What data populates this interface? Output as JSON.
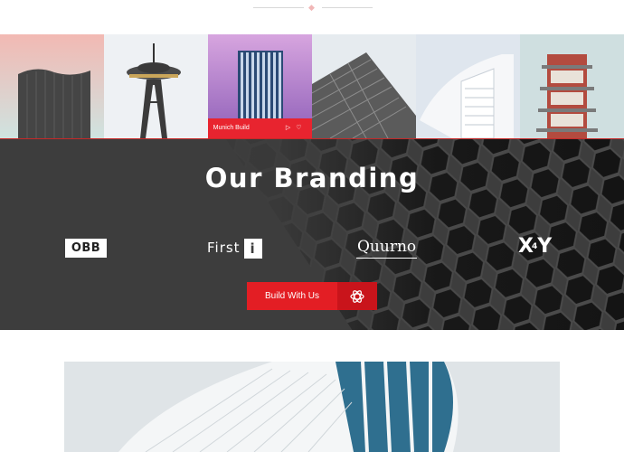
{
  "gallery": {
    "items": [
      {
        "name": "gallery-tile-1"
      },
      {
        "name": "gallery-tile-2"
      },
      {
        "name": "gallery-tile-3",
        "caption": "Munich Build"
      },
      {
        "name": "gallery-tile-4"
      },
      {
        "name": "gallery-tile-5"
      },
      {
        "name": "gallery-tile-6"
      }
    ],
    "caption_icons": [
      "play-icon",
      "heart-icon"
    ]
  },
  "branding": {
    "title": "Our Branding",
    "logos": {
      "obb": "OBB",
      "first_text": "First",
      "first_box": "i",
      "quurno": "Quurno",
      "xy_x": "X",
      "xy_sup": "4",
      "xy_y": "Y"
    },
    "cta_label": "Build With Us",
    "cta_icon": "spiral-logo-icon"
  },
  "colors": {
    "accent": "#e31e24",
    "band_bg": "#3d3d3d"
  }
}
